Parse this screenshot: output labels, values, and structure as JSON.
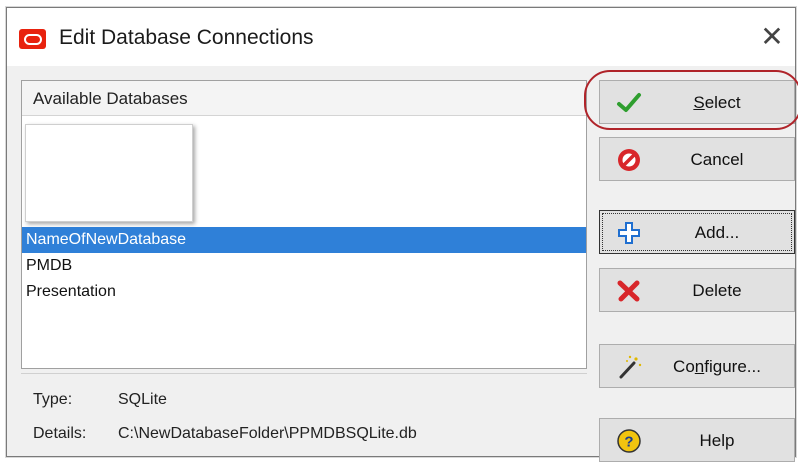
{
  "window": {
    "title": "Edit Database Connections",
    "close_glyph": "✕"
  },
  "list": {
    "header": "Available Databases",
    "items": [
      {
        "label": "NameOfNewDatabase",
        "selected": true
      },
      {
        "label": "PMDB",
        "selected": false
      },
      {
        "label": "Presentation",
        "selected": false
      }
    ]
  },
  "details": {
    "type_label": "Type:",
    "type_value": "SQLite",
    "details_label": "Details:",
    "details_value": "C:\\NewDatabaseFolder\\PPMDBSQLite.db"
  },
  "buttons": {
    "select": {
      "label": "Select",
      "icon": "checkmark-icon",
      "color": "#2e9e2e"
    },
    "cancel": {
      "label": "Cancel",
      "icon": "no-entry-icon",
      "color": "#d8262a"
    },
    "add": {
      "label": "Add...",
      "icon": "plus-icon",
      "color": "#1f6fd0"
    },
    "delete": {
      "label": "Delete",
      "icon": "red-x-icon",
      "color": "#d8262a"
    },
    "configure": {
      "label": "Configure...",
      "icon": "magic-wand-icon"
    },
    "help": {
      "label": "Help",
      "icon": "help-icon",
      "color": "#f1c40f"
    }
  },
  "accent": {
    "selection": "#2f80d8",
    "highlight_ring": "#b0242a",
    "app_icon": "#e8220e"
  }
}
